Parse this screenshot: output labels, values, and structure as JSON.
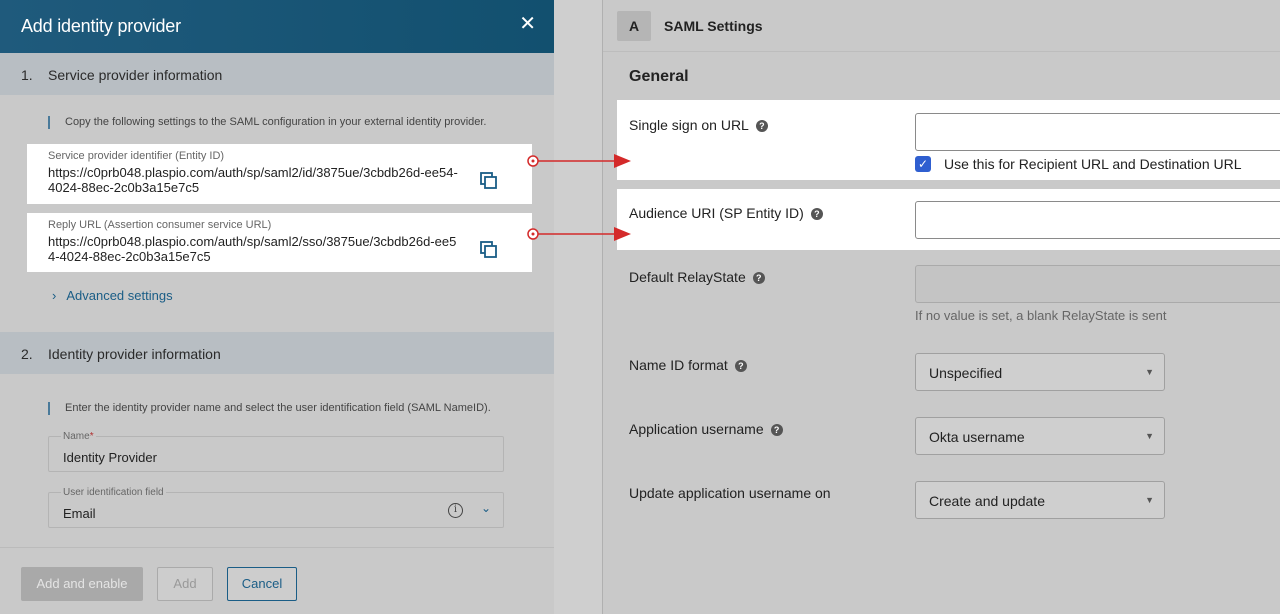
{
  "dialog": {
    "title": "Add identity provider",
    "close_glyph": "✕",
    "section1": {
      "number": "1.",
      "title": "Service provider information"
    },
    "section1_note": "Copy the following settings to the SAML configuration in your external identity provider.",
    "entity": {
      "caption": "Service provider identifier (Entity ID)",
      "value": "https://c0prb048.plaspio.com/auth/sp/saml2/id/3875ue/3cbdb26d-ee54-4024-88ec-2c0b3a15e7c5"
    },
    "reply": {
      "caption": "Reply URL (Assertion consumer service URL)",
      "value": "https://c0prb048.plaspio.com/auth/sp/saml2/sso/3875ue/3cbdb26d-ee54-4024-88ec-2c0b3a15e7c5"
    },
    "advanced": {
      "chevron": "›",
      "label": "Advanced settings"
    },
    "section2": {
      "number": "2.",
      "title": "Identity provider information"
    },
    "section2_note": "Enter the identity provider name and select the user identification field (SAML NameID).",
    "name_field": {
      "label": "Name",
      "required_mark": "*",
      "value": "Identity Provider"
    },
    "uid_field": {
      "label": "User identification field",
      "value": "Email",
      "info_glyph": "i",
      "dropdown_glyph": "⌄"
    },
    "footer": {
      "add_enable": "Add and enable",
      "add": "Add",
      "cancel": "Cancel"
    }
  },
  "saml": {
    "step_letter": "A",
    "step_title": "SAML Settings",
    "general": "General",
    "sso": {
      "label": "Single sign on URL",
      "help": "?",
      "value": "",
      "checkbox_glyph": "✓",
      "checkbox_label": "Use this for Recipient URL and Destination URL"
    },
    "audience": {
      "label": "Audience URI (SP Entity ID)",
      "help": "?",
      "value": ""
    },
    "relay": {
      "label": "Default RelayState",
      "help": "?",
      "value": "",
      "hint": "If no value is set, a blank RelayState is sent"
    },
    "nameid": {
      "label": "Name ID format",
      "help": "?",
      "value": "Unspecified",
      "arrow": "▼"
    },
    "appuser": {
      "label": "Application username",
      "help": "?",
      "value": "Okta username",
      "arrow": "▼"
    },
    "update": {
      "label": "Update application username on",
      "value": "Create and update",
      "arrow": "▼"
    }
  },
  "colors": {
    "header_bg": "#1f5a7c",
    "link": "#1a5d86",
    "arrow": "#d42a2a",
    "checkbox": "#2f5fd0"
  }
}
